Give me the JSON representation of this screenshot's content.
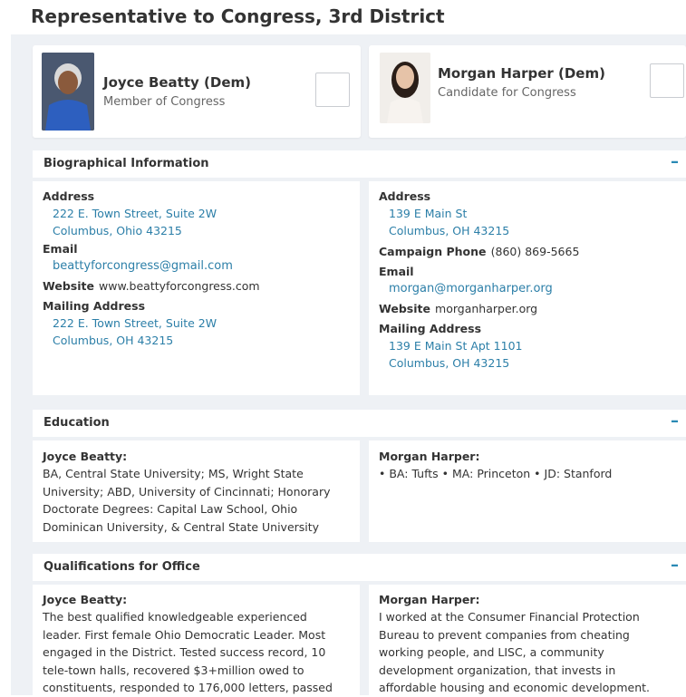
{
  "page": {
    "title": "Representative to Congress, 3rd District"
  },
  "candidates": [
    {
      "name": "Joyce Beatty (Dem)",
      "role": "Member of Congress"
    },
    {
      "name": "Morgan Harper (Dem)",
      "role": "Candidate for Congress"
    }
  ],
  "sections": {
    "bio": {
      "title": "Biographical Information",
      "collapse": "–",
      "left": {
        "address_label": "Address",
        "address_line1": "222 E. Town Street, Suite 2W",
        "address_line2": "Columbus, Ohio 43215",
        "email_label": "Email",
        "email": "beattyforcongress@gmail.com",
        "website_label": "Website",
        "website": "www.beattyforcongress.com",
        "mailing_label": "Mailing Address",
        "mailing_line1": "222 E. Town Street, Suite 2W",
        "mailing_line2": "Columbus, OH 43215"
      },
      "right": {
        "address_label": "Address",
        "address_line1": "139 E Main St",
        "address_line2": "Columbus, OH 43215",
        "phone_label": "Campaign Phone",
        "phone": "(860) 869-5665",
        "email_label": "Email",
        "email": "morgan@morganharper.org",
        "website_label": "Website",
        "website": "morganharper.org",
        "mailing_label": "Mailing Address",
        "mailing_line1": "139 E Main St Apt 1101",
        "mailing_line2": "Columbus, OH 43215"
      }
    },
    "education": {
      "title": "Education",
      "collapse": "–",
      "left": {
        "name": "Joyce Beatty:",
        "lines": [
          "BA, Central State University; MS, Wright State",
          "University; ABD, University of Cincinnati; Honorary",
          "Doctorate Degrees: Capital Law School, Ohio",
          "Dominican University, & Central State University"
        ]
      },
      "right": {
        "name": "Morgan Harper:",
        "lines": [
          "• BA: Tufts • MA: Princeton • JD: Stanford"
        ]
      }
    },
    "qualifications": {
      "title": "Qualifications for Office",
      "collapse": "–",
      "left": {
        "name": "Joyce Beatty:",
        "lines": [
          "The best qualified knowledgeable experienced",
          "leader. First female Ohio Democratic Leader. Most",
          "engaged in the District. Tested success record, 10",
          "tele-town halls, recovered $3+million owed to",
          "constituents, responded to 176,000 letters, passed"
        ]
      },
      "right": {
        "name": "Morgan Harper:",
        "lines": [
          "I worked at the Consumer Financial Protection",
          "Bureau to prevent companies from cheating",
          "working people, and LISC, a community",
          "development organization, that invests in",
          "affordable housing and economic development."
        ]
      }
    }
  }
}
